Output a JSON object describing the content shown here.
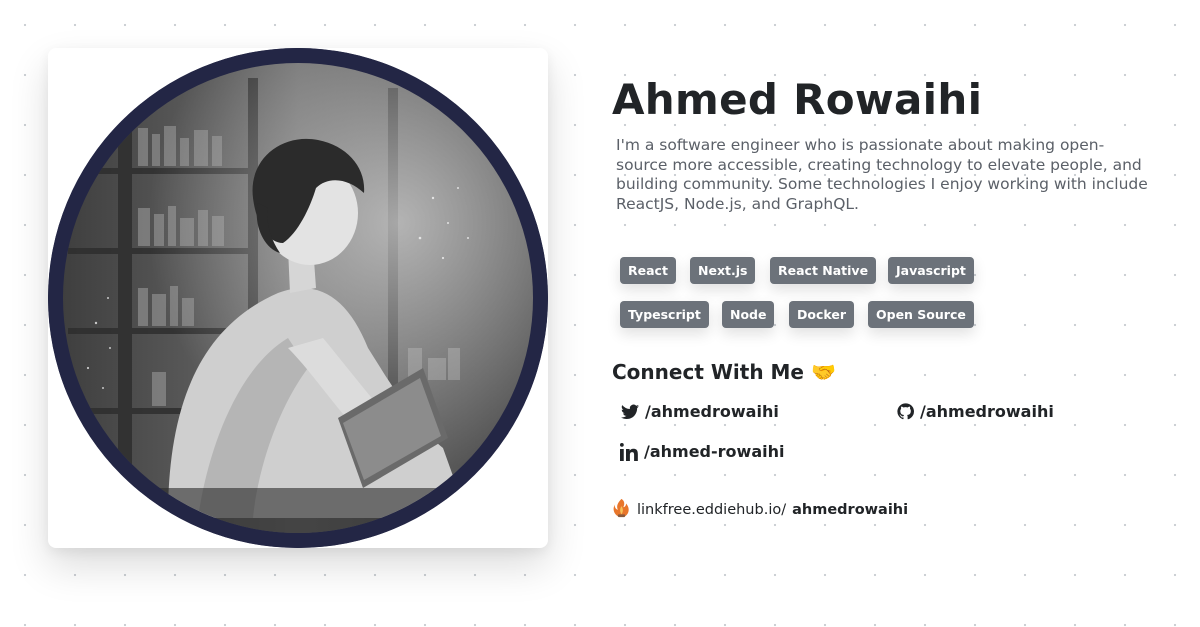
{
  "profile": {
    "name": "Ahmed Rowaihi",
    "bio": "I'm a software engineer who is passionate about making open-source more accessible, creating technology to elevate people, and building community. Some technologies I enjoy working with include ReactJS, Node.js, and GraphQL."
  },
  "skills": [
    "React",
    "Next.js",
    "React Native",
    "Javascript",
    "Typescript",
    "Node",
    "Docker",
    "Open Source"
  ],
  "connect": {
    "title": "Connect With Me 🤝",
    "twitter": "/ahmedrowaihi",
    "github": "/ahmedrowaihi",
    "linkedin": "/ahmed-rowaihi"
  },
  "footer": {
    "prefix": "linkfree.eddiehub.io/",
    "username": "ahmedrowaihi"
  },
  "icons": {
    "twitter": "twitter-icon",
    "github": "github-icon",
    "linkedin": "linkedin-icon",
    "linkfree": "linkfree-logo-icon"
  },
  "colors": {
    "chip_bg": "#6c727a",
    "avatar_ring": "#232645",
    "heading": "#212427",
    "bio_text": "#5b6068"
  }
}
